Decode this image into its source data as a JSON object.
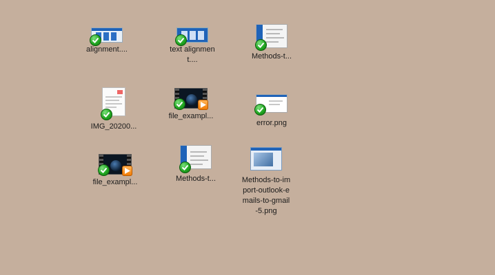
{
  "desktop": {
    "background_color": "#c5af9d",
    "icons": [
      {
        "label": "alignment....",
        "thumbnail": "blue-web-screenshot",
        "sync_status": "synced-check-icon"
      },
      {
        "label": "text alignment....",
        "thumbnail": "blue-web-screenshot",
        "sync_status": "synced-check-icon"
      },
      {
        "label": "Methods-t...",
        "thumbnail": "app-window-screenshot",
        "sync_status": "synced-check-icon"
      },
      {
        "label": "IMG_20200...",
        "thumbnail": "document-image",
        "sync_status": "synced-check-icon"
      },
      {
        "label": "file_exampl...",
        "thumbnail": "video-earth",
        "sync_status": "synced-check-icon",
        "overlay": "play-icon"
      },
      {
        "label": "error.png",
        "thumbnail": "dialog-screenshot",
        "sync_status": "synced-check-icon"
      },
      {
        "label": "file_exampl...",
        "thumbnail": "video-earth",
        "sync_status": "synced-check-icon",
        "overlay": "play-icon"
      },
      {
        "label": "Methods-t...",
        "thumbnail": "app-window-screenshot",
        "sync_status": "synced-check-icon"
      },
      {
        "label": "Methods-to-import-outlook-emails-to-gmail-5.png",
        "thumbnail": "outlook-screenshot",
        "sync_status": "none"
      }
    ]
  }
}
